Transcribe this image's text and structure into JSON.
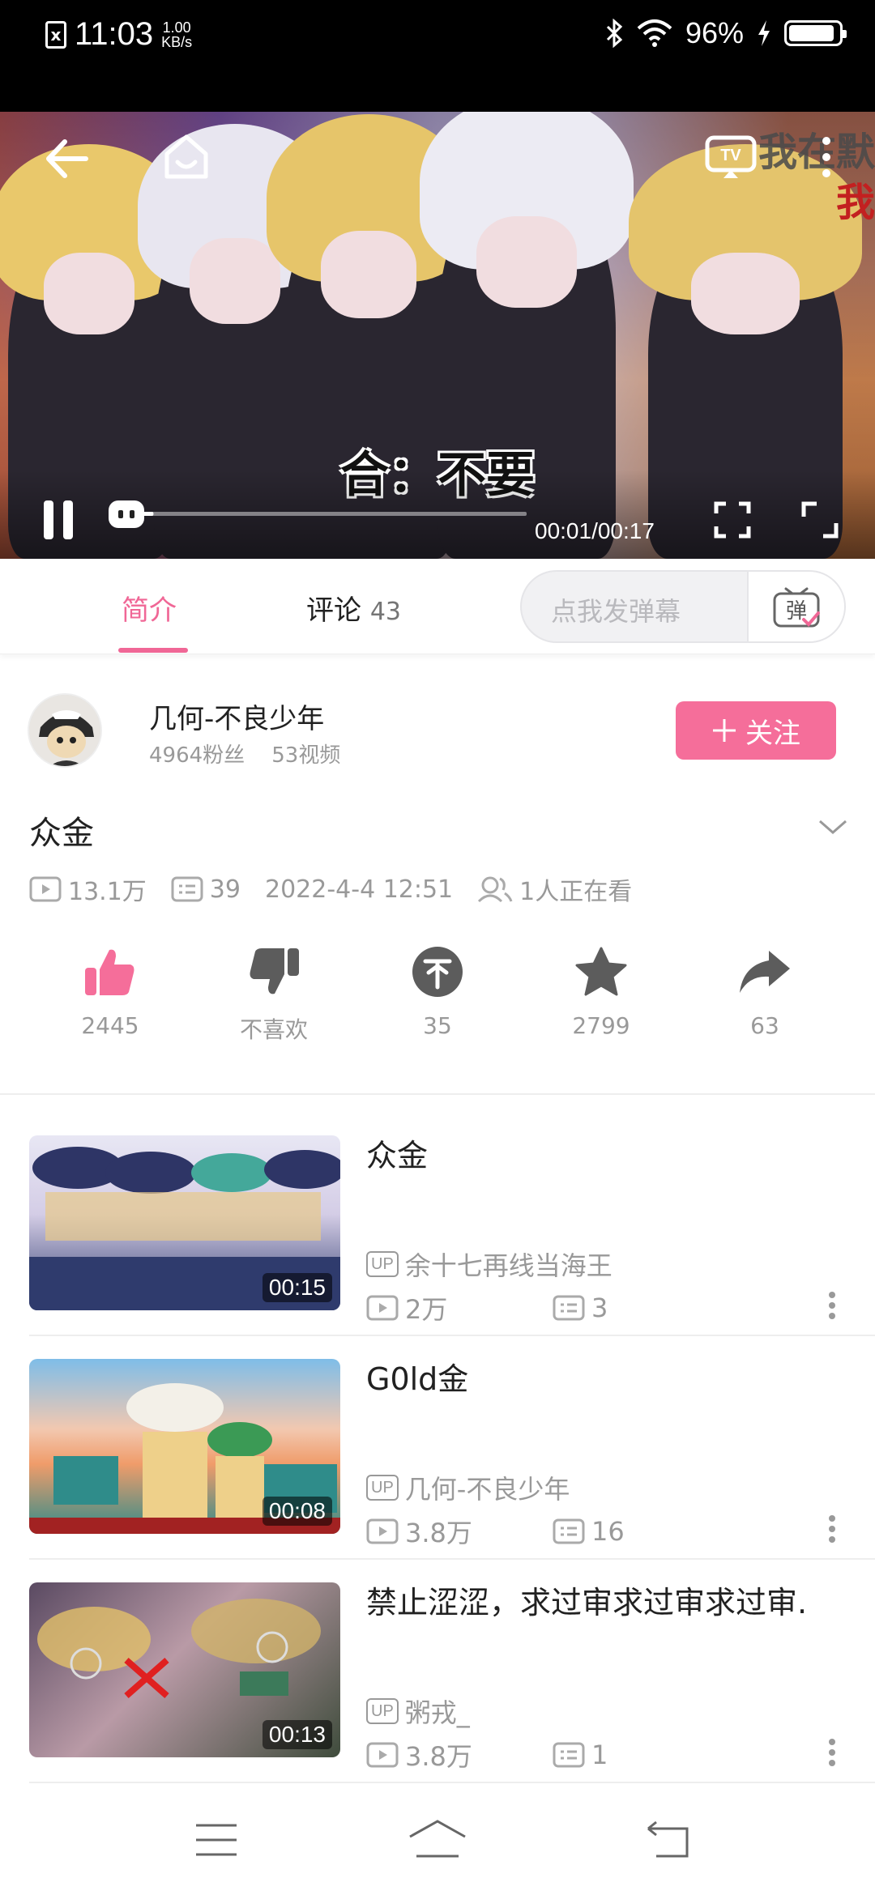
{
  "status_bar": {
    "notif_badge": "x",
    "time": "11:03",
    "speed_top": "1.00",
    "speed_bottom": "KB/s",
    "battery": "96%"
  },
  "player": {
    "caption": "合：不要",
    "watermark_top": "我在默",
    "watermark_bottom": "我",
    "time": "00:01/00:17",
    "progress_fraction": 0.06
  },
  "tabs": {
    "intro": "简介",
    "comments": "评论",
    "comments_count": "43",
    "danmaku_placeholder": "点我发弹幕",
    "danmaku_icon_label": "弹"
  },
  "uploader": {
    "name": "几何-不良少年",
    "fans": "4964粉丝",
    "videos": "53视频",
    "follow_label": "关注"
  },
  "video": {
    "title": "众金",
    "views": "13.1万",
    "danmaku": "39",
    "date": "2022-4-4 12:51",
    "watching": "1人正在看"
  },
  "actions": [
    {
      "label": "2445",
      "icon": "thumbs-up-icon"
    },
    {
      "label": "不喜欢",
      "icon": "thumbs-down-icon"
    },
    {
      "label": "35",
      "icon": "coin-icon"
    },
    {
      "label": "2799",
      "icon": "star-icon"
    },
    {
      "label": "63",
      "icon": "share-icon"
    }
  ],
  "related": [
    {
      "title": "众金",
      "uploader": "余十七再线当海王",
      "views": "2万",
      "danmaku": "3",
      "duration": "00:15"
    },
    {
      "title": "G0ld金",
      "uploader": "几何-不良少年",
      "views": "3.8万",
      "danmaku": "16",
      "duration": "00:08"
    },
    {
      "title": "禁止涩涩，求过审求过审求过审.",
      "uploader": "粥戎_",
      "views": "3.8万",
      "danmaku": "1",
      "duration": "00:13"
    }
  ],
  "colors": {
    "accent": "#f06796",
    "follow": "#f56e9a",
    "muted": "#999999"
  }
}
